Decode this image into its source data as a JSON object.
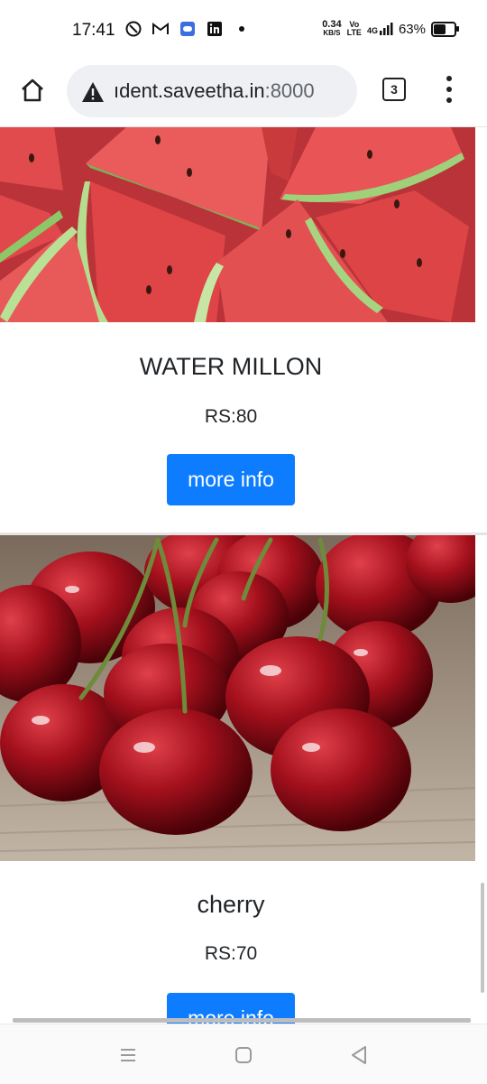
{
  "status_bar": {
    "time": "17:41",
    "speed_value": "0.34",
    "speed_unit": "KB/S",
    "net_top": "Vo",
    "net_bottom": "LTE",
    "signal_label": "4G",
    "battery_pct": "63%",
    "battery_level": 0.63,
    "icons": [
      "shield-icon",
      "gmail-icon",
      "discord-icon",
      "linkedin-icon",
      "dot-icon"
    ]
  },
  "browser": {
    "url_host": "ıdent.saveetha.in",
    "url_port": ":8000",
    "tab_count": "3",
    "warning_icon": "warning-icon",
    "home_icon": "home-icon",
    "menu_icon": "kebab-menu-icon"
  },
  "products": [
    {
      "name": "WATER MILLON",
      "price": "RS:80",
      "button_label": "more info",
      "image": "watermelon-slices"
    },
    {
      "name": "cherry",
      "price": "RS:70",
      "button_label": "more info",
      "image": "cherries"
    }
  ],
  "navbar": {
    "icons": [
      "recent-apps-icon",
      "home-nav-icon",
      "back-icon"
    ]
  },
  "colors": {
    "primary_button": "#0d7cff",
    "watermelon_red": "#e24b4e",
    "cherry_red": "#a3101c"
  }
}
